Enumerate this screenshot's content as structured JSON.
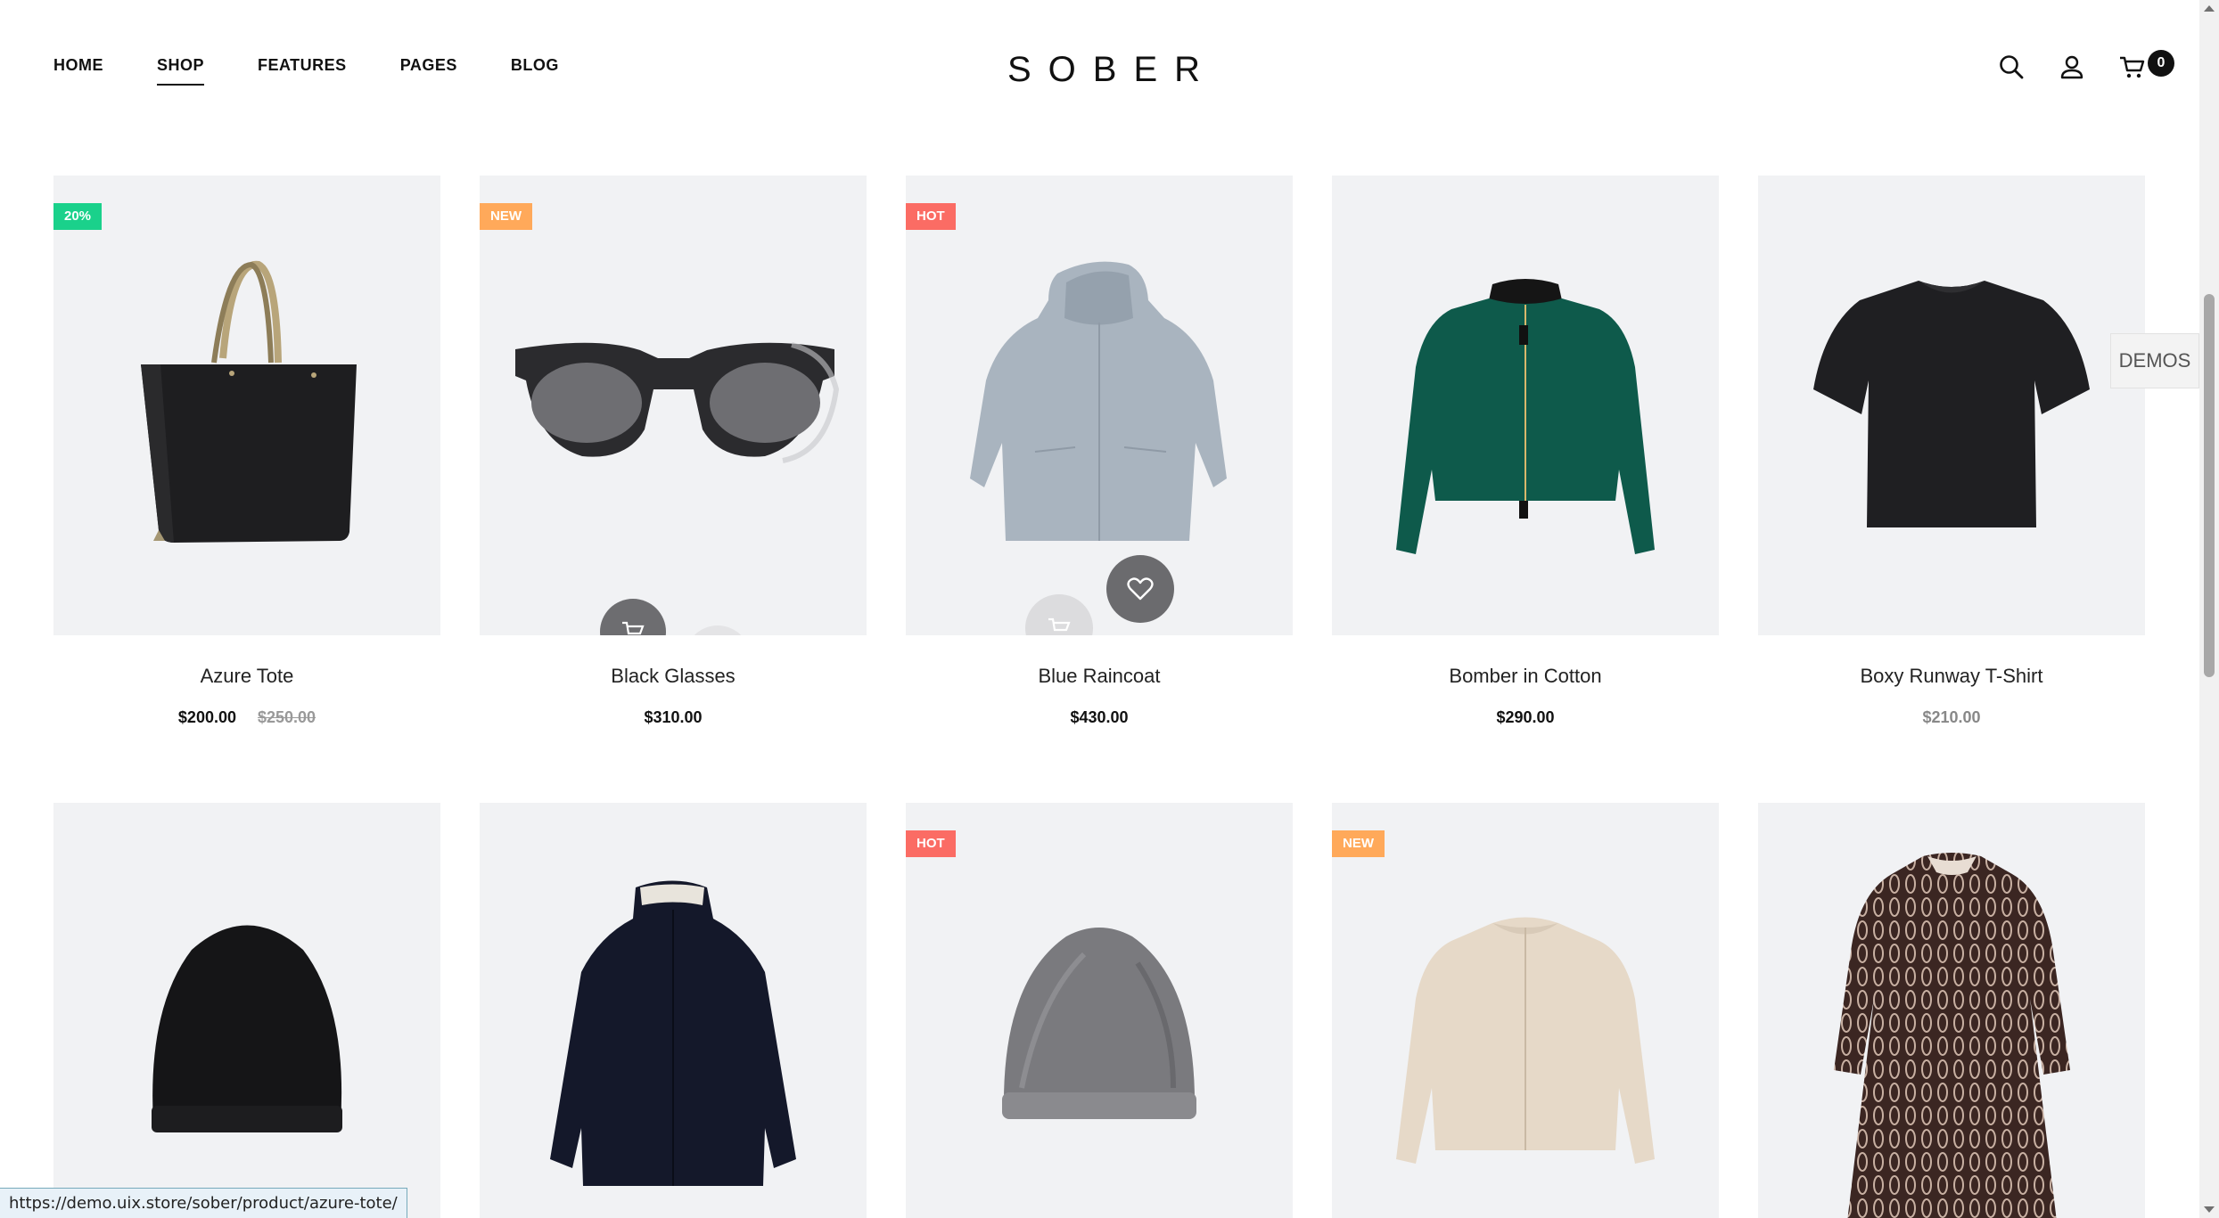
{
  "nav": {
    "items": [
      {
        "label": "HOME"
      },
      {
        "label": "SHOP"
      },
      {
        "label": "FEATURES"
      },
      {
        "label": "PAGES"
      },
      {
        "label": "BLOG"
      }
    ]
  },
  "logo": {
    "text": "SOBER"
  },
  "header": {
    "cart_count": "0"
  },
  "products": [
    {
      "name": "Azure Tote",
      "price": "$200.00",
      "old_price": "$250.00",
      "badge": "20%"
    },
    {
      "name": "Black Glasses",
      "price": "$310.00",
      "badge": "NEW"
    },
    {
      "name": "Blue Raincoat",
      "price": "$430.00",
      "badge": "HOT"
    },
    {
      "name": "Bomber in Cotton",
      "price": "$290.00"
    },
    {
      "name": "Boxy Runway T-Shirt",
      "price": "$210.00"
    },
    {
      "name": "",
      "price": ""
    },
    {
      "name": "",
      "price": ""
    },
    {
      "name": "",
      "price": "",
      "badge": "HOT"
    },
    {
      "name": "",
      "price": "",
      "badge": "NEW"
    },
    {
      "name": "",
      "price": ""
    }
  ],
  "demos": {
    "label": "DEMOS"
  },
  "status_bar": {
    "url": "https://demo.uix.store/sober/product/azure-tote/"
  },
  "colors": {
    "sale": "#1ad18b",
    "new": "#ffa95a",
    "hot": "#fb6c64",
    "image_bg": "#f1f2f4"
  }
}
